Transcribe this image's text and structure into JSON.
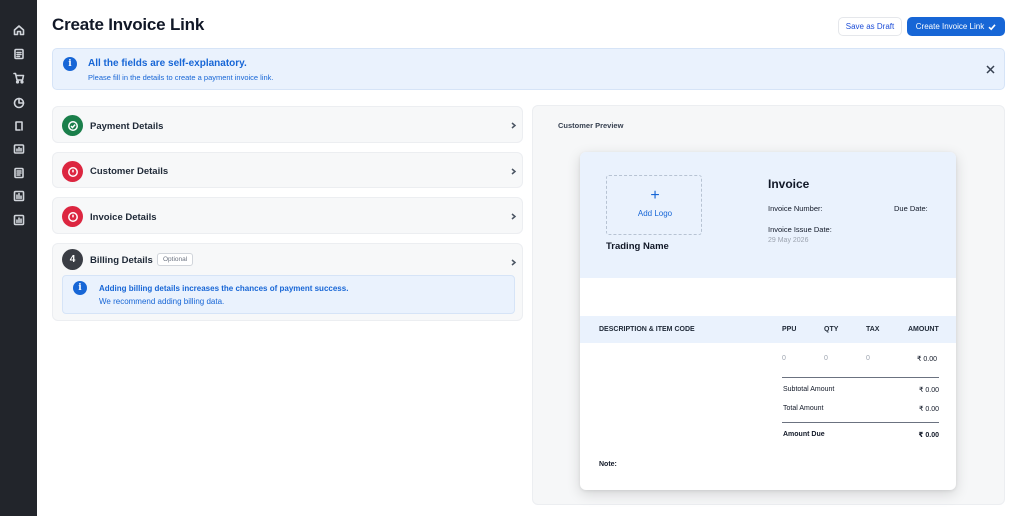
{
  "sidebar": {
    "icons": [
      "home-icon",
      "document-icon",
      "cart-icon",
      "pie-chart-icon",
      "link-icon",
      "report-icon",
      "checklist-icon",
      "analytics-icon",
      "bar-chart-icon"
    ]
  },
  "header": {
    "title": "Create Invoice Link",
    "save_draft_label": "Save as Draft",
    "create_label": "Create Invoice Link"
  },
  "banner": {
    "title": "All the fields are self-explanatory.",
    "subtitle": "Please fill in the details to create a payment invoice link."
  },
  "sections": [
    {
      "label": "Payment Details",
      "status": "complete"
    },
    {
      "label": "Customer Details",
      "status": "error"
    },
    {
      "label": "Invoice Details",
      "status": "error"
    },
    {
      "label": "Billing Details",
      "status": "step",
      "step": "4",
      "badge": "Optional"
    }
  ],
  "billing_note": {
    "line1": "Adding billing details increases the chances of payment success.",
    "line2": "We recommend adding billing data."
  },
  "preview": {
    "title": "Customer Preview",
    "add_logo": "Add Logo",
    "plus": "+",
    "trading_name": "Trading Name",
    "invoice_title": "Invoice",
    "invoice_number_label": "Invoice Number:",
    "due_date_label": "Due Date:",
    "issue_date_label": "Invoice Issue Date:",
    "issue_date": "29 May 2026",
    "columns": [
      "DESCRIPTION & ITEM CODE",
      "PPU",
      "QTY",
      "TAX",
      "AMOUNT"
    ],
    "row": {
      "ppu": "0",
      "qty": "0",
      "tax": "0",
      "amount": "₹ 0.00"
    },
    "subtotal_label": "Subtotal Amount",
    "subtotal": "₹ 0.00",
    "total_label": "Total Amount",
    "total": "₹ 0.00",
    "amount_due_label": "Amount Due",
    "amount_due": "₹ 0.00",
    "note_label": "Note:"
  },
  "colors": {
    "accent": "#1766d6",
    "success": "#1a7f4b",
    "error": "#dc2640",
    "sidebar": "#22252b",
    "banner_bg": "#eaf2fd"
  }
}
